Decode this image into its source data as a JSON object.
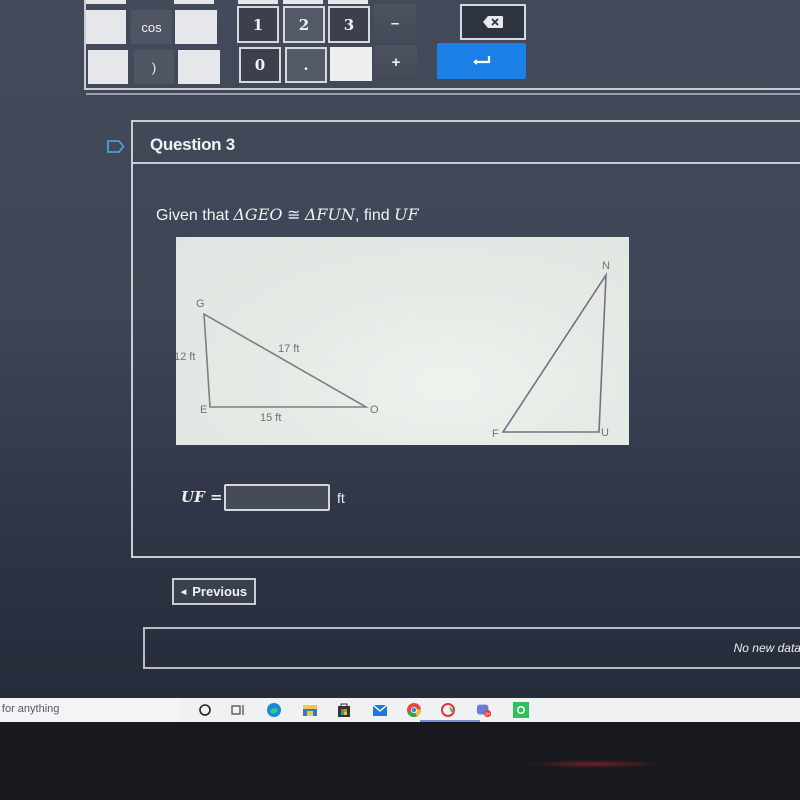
{
  "keypad": {
    "row1": {
      "left_keys": [
        "",
        "cos",
        ""
      ],
      "num_keys": [
        "1",
        "2",
        "3"
      ],
      "op": "–",
      "backspace_icon": "backspace-icon"
    },
    "row2": {
      "left_keys": [
        "",
        ")",
        ""
      ],
      "num_keys": [
        "0",
        ".",
        ""
      ],
      "op": "+",
      "enter_icon": "enter-icon"
    },
    "accent_color": "#1a7fe6"
  },
  "question": {
    "bookmark_icon": "bookmark-icon",
    "title": "Question 3",
    "prompt_prefix": "Given that ",
    "triangle1": "ΔGEO",
    "congruent": " ≅ ",
    "triangle2": "ΔFUN",
    "prompt_find": ", find ",
    "target": "UF",
    "figure": {
      "triangle_geo": {
        "vertices": [
          "G",
          "E",
          "O"
        ],
        "sides": {
          "GE": "12 ft",
          "EO": "15 ft",
          "GO": "17 ft"
        }
      },
      "triangle_fun": {
        "vertices": [
          "N",
          "F",
          "U"
        ]
      }
    },
    "answer": {
      "label": "UF =",
      "value": "",
      "unit": "ft"
    }
  },
  "navigation": {
    "previous_label": "Previous"
  },
  "status": {
    "message": "No new data to save"
  },
  "taskbar": {
    "search_text": "Search for anything",
    "icons": [
      "cortana-icon",
      "task-view-icon",
      "edge-icon",
      "file-explorer-icon",
      "store-icon",
      "mail-icon",
      "chrome-icon",
      "app-icon",
      "discord-icon",
      "spotify-icon"
    ],
    "discord_badge": "9+"
  }
}
